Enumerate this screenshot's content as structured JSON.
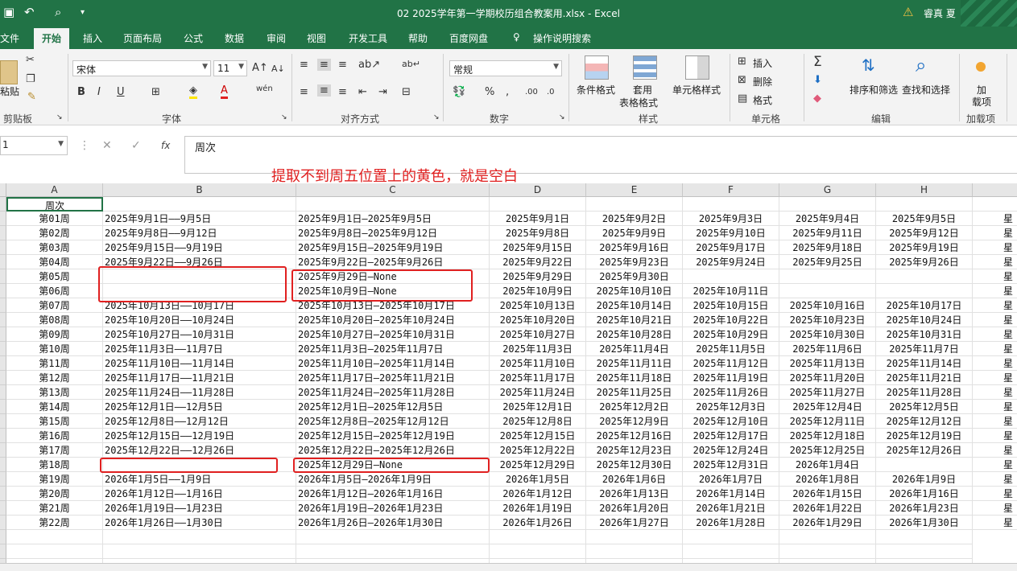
{
  "window": {
    "title": "02 2025学年第一学期校历组合教案用.xlsx - Excel",
    "user": "睿真 夏"
  },
  "menu": [
    "文件",
    "开始",
    "插入",
    "页面布局",
    "公式",
    "数据",
    "审阅",
    "视图",
    "开发工具",
    "帮助",
    "百度网盘",
    "操作说明搜索"
  ],
  "ribbon": {
    "clipboard_label": "剪贴板",
    "paste_label": "粘贴",
    "font_label": "字体",
    "font_name": "宋体",
    "font_size": "11",
    "align_label": "对齐方式",
    "number_label": "数字",
    "number_format": "常规",
    "styles_label": "样式",
    "cond_format": "条件格式",
    "table_format_1": "套用",
    "table_format_2": "表格格式",
    "cell_style": "单元格样式",
    "cells_label": "单元格",
    "insert": "插入",
    "delete": "删除",
    "format": "格式",
    "edit_label": "编辑",
    "sort_filter": "排序和筛选",
    "find_select": "查找和选择",
    "addins_1": "加",
    "addins_2": "载项",
    "addins_label": "加载项",
    "colors": {
      "accent": "#217346",
      "annotation": "#e02020"
    }
  },
  "formula_bar": {
    "name_box": "1",
    "content": "周次"
  },
  "annotation": "提取不到周五位置上的黄色，就是空白",
  "columns": [
    "A",
    "B",
    "C",
    "D",
    "E",
    "F",
    "G",
    "H"
  ],
  "right_col_fragment": "星",
  "header_row": [
    "周次",
    "",
    "",
    "",
    "",
    "",
    "",
    ""
  ],
  "rows": [
    [
      "第01周",
      "2025年9月1日——9月5日",
      "2025年9月1日—2025年9月5日",
      "2025年9月1日",
      "2025年9月2日",
      "2025年9月3日",
      "2025年9月4日",
      "2025年9月5日"
    ],
    [
      "第02周",
      "2025年9月8日——9月12日",
      "2025年9月8日—2025年9月12日",
      "2025年9月8日",
      "2025年9月9日",
      "2025年9月10日",
      "2025年9月11日",
      "2025年9月12日"
    ],
    [
      "第03周",
      "2025年9月15日——9月19日",
      "2025年9月15日—2025年9月19日",
      "2025年9月15日",
      "2025年9月16日",
      "2025年9月17日",
      "2025年9月18日",
      "2025年9月19日"
    ],
    [
      "第04周",
      "2025年9月22日——9月26日",
      "2025年9月22日—2025年9月26日",
      "2025年9月22日",
      "2025年9月23日",
      "2025年9月24日",
      "2025年9月25日",
      "2025年9月26日"
    ],
    [
      "第05周",
      "",
      "2025年9月29日—None",
      "2025年9月29日",
      "2025年9月30日",
      "",
      "",
      ""
    ],
    [
      "第06周",
      "",
      "2025年10月9日—None",
      "2025年10月9日",
      "2025年10月10日",
      "2025年10月11日",
      "",
      ""
    ],
    [
      "第07周",
      "2025年10月13日——10月17日",
      "2025年10月13日—2025年10月17日",
      "2025年10月13日",
      "2025年10月14日",
      "2025年10月15日",
      "2025年10月16日",
      "2025年10月17日"
    ],
    [
      "第08周",
      "2025年10月20日——10月24日",
      "2025年10月20日—2025年10月24日",
      "2025年10月20日",
      "2025年10月21日",
      "2025年10月22日",
      "2025年10月23日",
      "2025年10月24日"
    ],
    [
      "第09周",
      "2025年10月27日——10月31日",
      "2025年10月27日—2025年10月31日",
      "2025年10月27日",
      "2025年10月28日",
      "2025年10月29日",
      "2025年10月30日",
      "2025年10月31日"
    ],
    [
      "第10周",
      "2025年11月3日——11月7日",
      "2025年11月3日—2025年11月7日",
      "2025年11月3日",
      "2025年11月4日",
      "2025年11月5日",
      "2025年11月6日",
      "2025年11月7日"
    ],
    [
      "第11周",
      "2025年11月10日——11月14日",
      "2025年11月10日—2025年11月14日",
      "2025年11月10日",
      "2025年11月11日",
      "2025年11月12日",
      "2025年11月13日",
      "2025年11月14日"
    ],
    [
      "第12周",
      "2025年11月17日——11月21日",
      "2025年11月17日—2025年11月21日",
      "2025年11月17日",
      "2025年11月18日",
      "2025年11月19日",
      "2025年11月20日",
      "2025年11月21日"
    ],
    [
      "第13周",
      "2025年11月24日——11月28日",
      "2025年11月24日—2025年11月28日",
      "2025年11月24日",
      "2025年11月25日",
      "2025年11月26日",
      "2025年11月27日",
      "2025年11月28日"
    ],
    [
      "第14周",
      "2025年12月1日——12月5日",
      "2025年12月1日—2025年12月5日",
      "2025年12月1日",
      "2025年12月2日",
      "2025年12月3日",
      "2025年12月4日",
      "2025年12月5日"
    ],
    [
      "第15周",
      "2025年12月8日——12月12日",
      "2025年12月8日—2025年12月12日",
      "2025年12月8日",
      "2025年12月9日",
      "2025年12月10日",
      "2025年12月11日",
      "2025年12月12日"
    ],
    [
      "第16周",
      "2025年12月15日——12月19日",
      "2025年12月15日—2025年12月19日",
      "2025年12月15日",
      "2025年12月16日",
      "2025年12月17日",
      "2025年12月18日",
      "2025年12月19日"
    ],
    [
      "第17周",
      "2025年12月22日——12月26日",
      "2025年12月22日—2025年12月26日",
      "2025年12月22日",
      "2025年12月23日",
      "2025年12月24日",
      "2025年12月25日",
      "2025年12月26日"
    ],
    [
      "第18周",
      "",
      "2025年12月29日—None",
      "2025年12月29日",
      "2025年12月30日",
      "2025年12月31日",
      "2026年1月4日",
      ""
    ],
    [
      "第19周",
      "2026年1月5日——1月9日",
      "2026年1月5日—2026年1月9日",
      "2026年1月5日",
      "2026年1月6日",
      "2026年1月7日",
      "2026年1月8日",
      "2026年1月9日"
    ],
    [
      "第20周",
      "2026年1月12日——1月16日",
      "2026年1月12日—2026年1月16日",
      "2026年1月12日",
      "2026年1月13日",
      "2026年1月14日",
      "2026年1月15日",
      "2026年1月16日"
    ],
    [
      "第21周",
      "2026年1月19日——1月23日",
      "2026年1月19日—2026年1月23日",
      "2026年1月19日",
      "2026年1月20日",
      "2026年1月21日",
      "2026年1月22日",
      "2026年1月23日"
    ],
    [
      "第22周",
      "2026年1月26日——1月30日",
      "2026年1月26日—2026年1月30日",
      "2026年1月26日",
      "2026年1月27日",
      "2026年1月28日",
      "2026年1月29日",
      "2026年1月30日"
    ]
  ]
}
